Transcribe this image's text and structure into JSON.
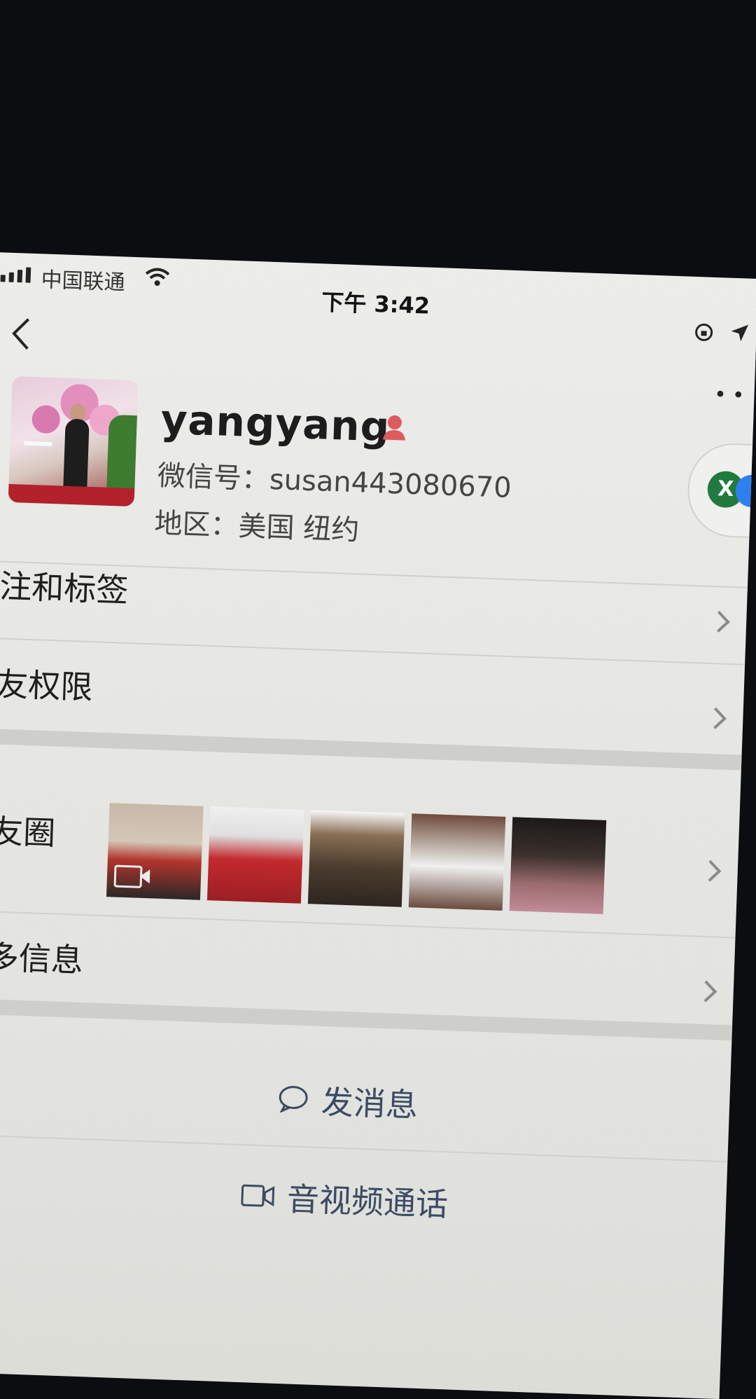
{
  "status_bar": {
    "carrier": "中国联通",
    "time": "下午 3:42"
  },
  "profile": {
    "nickname": "yangyang",
    "wechat_id": "微信号：susan443080670",
    "region": "地区：美国 纽约"
  },
  "menu": {
    "remarks": "备注和标签",
    "friend_permissions": "朋友权限",
    "moments": "朋友圈",
    "more_info": "更多信息"
  },
  "actions": {
    "send_message": "发消息",
    "video_call": "音视频通话"
  },
  "floating": {
    "badge_letter": "X"
  },
  "colors": {
    "accent_blue_text": "#3a4a63",
    "gender_icon": "#e05a5a"
  }
}
